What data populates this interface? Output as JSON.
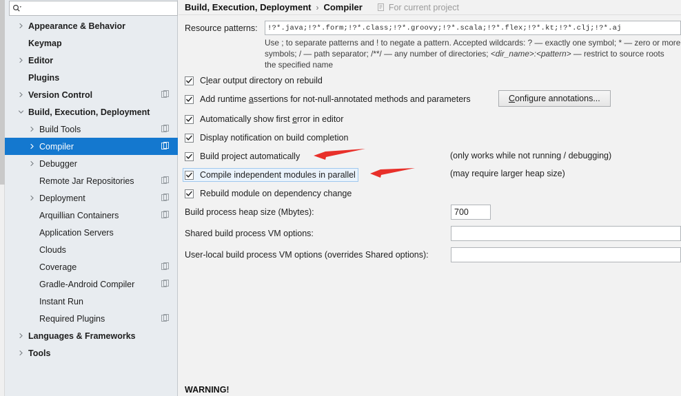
{
  "sidebar": {
    "search": {
      "placeholder": "",
      "value": "",
      "icon": "search-icon"
    },
    "items": [
      {
        "label": "Appearance & Behavior",
        "level": 0,
        "twisty": "chevron-right",
        "bold": true,
        "copy": false,
        "selected": false
      },
      {
        "label": "Keymap",
        "level": 0,
        "twisty": "none",
        "bold": true,
        "copy": false,
        "selected": false
      },
      {
        "label": "Editor",
        "level": 0,
        "twisty": "chevron-right",
        "bold": true,
        "copy": false,
        "selected": false
      },
      {
        "label": "Plugins",
        "level": 0,
        "twisty": "none",
        "bold": true,
        "copy": false,
        "selected": false
      },
      {
        "label": "Version Control",
        "level": 0,
        "twisty": "chevron-right",
        "bold": true,
        "copy": true,
        "selected": false
      },
      {
        "label": "Build, Execution, Deployment",
        "level": 0,
        "twisty": "chevron-down",
        "bold": true,
        "copy": false,
        "selected": false
      },
      {
        "label": "Build Tools",
        "level": 1,
        "twisty": "chevron-right",
        "bold": false,
        "copy": true,
        "selected": false
      },
      {
        "label": "Compiler",
        "level": 1,
        "twisty": "chevron-right",
        "bold": false,
        "copy": true,
        "selected": true
      },
      {
        "label": "Debugger",
        "level": 1,
        "twisty": "chevron-right",
        "bold": false,
        "copy": false,
        "selected": false
      },
      {
        "label": "Remote Jar Repositories",
        "level": 1,
        "twisty": "none",
        "bold": false,
        "copy": true,
        "selected": false
      },
      {
        "label": "Deployment",
        "level": 1,
        "twisty": "chevron-right",
        "bold": false,
        "copy": true,
        "selected": false
      },
      {
        "label": "Arquillian Containers",
        "level": 1,
        "twisty": "none",
        "bold": false,
        "copy": true,
        "selected": false
      },
      {
        "label": "Application Servers",
        "level": 1,
        "twisty": "none",
        "bold": false,
        "copy": false,
        "selected": false
      },
      {
        "label": "Clouds",
        "level": 1,
        "twisty": "none",
        "bold": false,
        "copy": false,
        "selected": false
      },
      {
        "label": "Coverage",
        "level": 1,
        "twisty": "none",
        "bold": false,
        "copy": true,
        "selected": false
      },
      {
        "label": "Gradle-Android Compiler",
        "level": 1,
        "twisty": "none",
        "bold": false,
        "copy": true,
        "selected": false
      },
      {
        "label": "Instant Run",
        "level": 1,
        "twisty": "none",
        "bold": false,
        "copy": false,
        "selected": false
      },
      {
        "label": "Required Plugins",
        "level": 1,
        "twisty": "none",
        "bold": false,
        "copy": true,
        "selected": false
      },
      {
        "label": "Languages & Frameworks",
        "level": 0,
        "twisty": "chevron-right",
        "bold": true,
        "copy": false,
        "selected": false
      },
      {
        "label": "Tools",
        "level": 0,
        "twisty": "chevron-right",
        "bold": true,
        "copy": false,
        "selected": false
      }
    ]
  },
  "header": {
    "crumb_root": "Build, Execution, Deployment",
    "crumb_sep": "›",
    "crumb_leaf": "Compiler",
    "scope_label": "For current project",
    "scope_icon": "project-scope-icon"
  },
  "form": {
    "resource_patterns_label": "Resource patterns:",
    "resource_patterns_value": "!?*.java;!?*.form;!?*.class;!?*.groovy;!?*.scala;!?*.flex;!?*.kt;!?*.clj;!?*.aj",
    "hint_line1": "Use ; to separate patterns and ! to negate a pattern. Accepted wildcards: ? — exactly one symbol; * — zero or more",
    "hint_line2_a": "symbols; / — path separator; /**/ — any number of directories; ",
    "hint_line2_italic": "<dir_name>:<pattern>",
    "hint_line2_b": " — restrict to source roots",
    "hint_line3": "the specified name",
    "checkboxes": [
      {
        "label": "Clear output directory on rebuild",
        "checked": true,
        "focused": false,
        "mnemonic": "l"
      },
      {
        "label": "Add runtime assertions for not-null-annotated methods and parameters",
        "checked": true,
        "focused": false,
        "mnemonic": "a"
      },
      {
        "label": "Automatically show first error in editor",
        "checked": true,
        "focused": false,
        "mnemonic": "e"
      },
      {
        "label": "Display notification on build completion",
        "checked": true,
        "focused": false,
        "mnemonic": ""
      },
      {
        "label": "Build project automatically",
        "checked": true,
        "focused": false,
        "mnemonic": ""
      },
      {
        "label": "Compile independent modules in parallel",
        "checked": true,
        "focused": true,
        "mnemonic": ""
      },
      {
        "label": "Rebuild module on dependency change",
        "checked": true,
        "focused": false,
        "mnemonic": ""
      }
    ],
    "configure_annotations_button": "Configure annotations...",
    "note_build_auto": "(only works while not running / debugging)",
    "note_parallel": "(may require larger heap size)",
    "heap_label": "Build process heap size (Mbytes):",
    "heap_value": "700",
    "shared_vm_label": "Shared build process VM options:",
    "shared_vm_value": "",
    "user_vm_label": "User-local build process VM options (overrides Shared options):",
    "user_vm_value": "",
    "warning": "WARNING!"
  },
  "colors": {
    "selection_blue": "#1478cf",
    "annotation_red": "#e8302a",
    "sidebar_bg": "#e8ecf0",
    "panel_bg": "#f2f2f2",
    "focus_ring": "#9fc8ee"
  }
}
